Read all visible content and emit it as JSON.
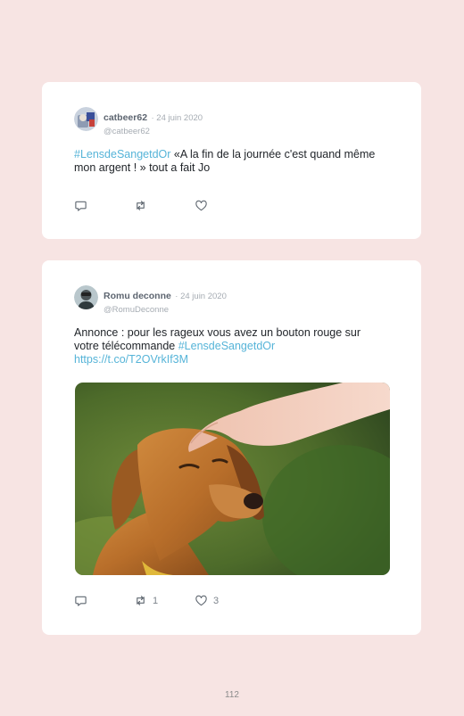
{
  "tweets": [
    {
      "name": "catbeer62",
      "date": "· 24 juin 2020",
      "handle": "@catbeer62",
      "hashtag": "#LensdeSangetdOr",
      "text": " «A la fin de la journée c'est quand même mon argent ! » tout a fait Jo",
      "retweets": "",
      "likes": ""
    },
    {
      "name": "Romu deconne",
      "date": "· 24 juin 2020",
      "handle": "@RomuDeconne",
      "text_before": "Annonce : pour les rageux vous avez un bouton rouge sur votre télécommande ",
      "hashtag": "#LensdeSangetdOr",
      "link": "https://t.co/T2OVrkIf3M",
      "retweets": "1",
      "likes": "3"
    }
  ],
  "icons": {
    "reply": "reply-icon",
    "retweet": "retweet-icon",
    "like": "heart-icon"
  },
  "colors": {
    "background": "#f7e4e3",
    "hashtag": "#56b4d8"
  },
  "page_number": "112"
}
